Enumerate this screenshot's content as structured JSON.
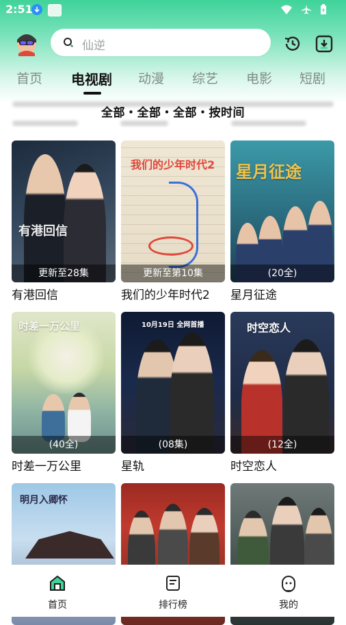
{
  "status": {
    "time": "2:51"
  },
  "search": {
    "placeholder": "仙逆"
  },
  "tabs": [
    {
      "label": "首页"
    },
    {
      "label": "电视剧"
    },
    {
      "label": "动漫"
    },
    {
      "label": "综艺"
    },
    {
      "label": "电影"
    },
    {
      "label": "短剧"
    }
  ],
  "active_tab": "电视剧",
  "filter": {
    "summary": "全部・全部・全部・按时间"
  },
  "cards": [
    {
      "title": "有港回信",
      "badge": "更新至28集",
      "poster_text": "有港回信"
    },
    {
      "title": "我们的少年时代2",
      "badge": "更新至第10集",
      "poster_text": "我们的少年时代2"
    },
    {
      "title": "星月征途",
      "badge": "(20全)",
      "poster_text": "星月征途"
    },
    {
      "title": "时差一万公里",
      "badge": "(40全)",
      "poster_text": "时差一万公里"
    },
    {
      "title": "星轨",
      "badge": "(08集)",
      "poster_text": "10月19日 全网首播"
    },
    {
      "title": "时空恋人",
      "badge": "(12全)",
      "poster_text": "时空恋人"
    },
    {
      "title": "",
      "badge": "",
      "poster_text": "明月入卿怀"
    },
    {
      "title": "",
      "badge": "",
      "poster_text": ""
    },
    {
      "title": "",
      "badge": "",
      "poster_text": ""
    }
  ],
  "bottom_nav": [
    {
      "label": "首页",
      "icon": "home-icon",
      "active": true
    },
    {
      "label": "排行榜",
      "icon": "ranking-icon",
      "active": false
    },
    {
      "label": "我的",
      "icon": "profile-icon",
      "active": false
    }
  ],
  "colors": {
    "accent": "#3fd39a",
    "text": "#111111",
    "muted": "#7f8c88"
  }
}
